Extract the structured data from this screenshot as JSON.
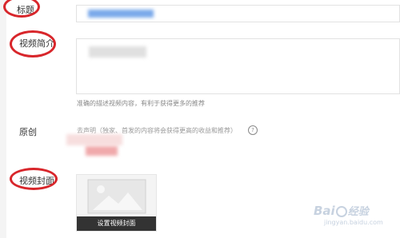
{
  "form": {
    "title_label": "标题",
    "desc_label": "视频简介",
    "desc_hint": "准确的描述视频内容，有利于获得更多的推荐",
    "original_label": "原创",
    "original_statement": "去声明（独家、首发的内容将会获得更高的收益和推荐）",
    "cover_label": "视频封面",
    "cover_button": "设置视频封面"
  },
  "watermark": {
    "brand_left": "Bai",
    "brand_right": "经验",
    "url": "jingyan.baidu.com"
  },
  "colors": {
    "annotation_red": "#d8262b",
    "blurred_blue": "#7aa9ea",
    "blurred_pink": "#f0a9ab"
  }
}
